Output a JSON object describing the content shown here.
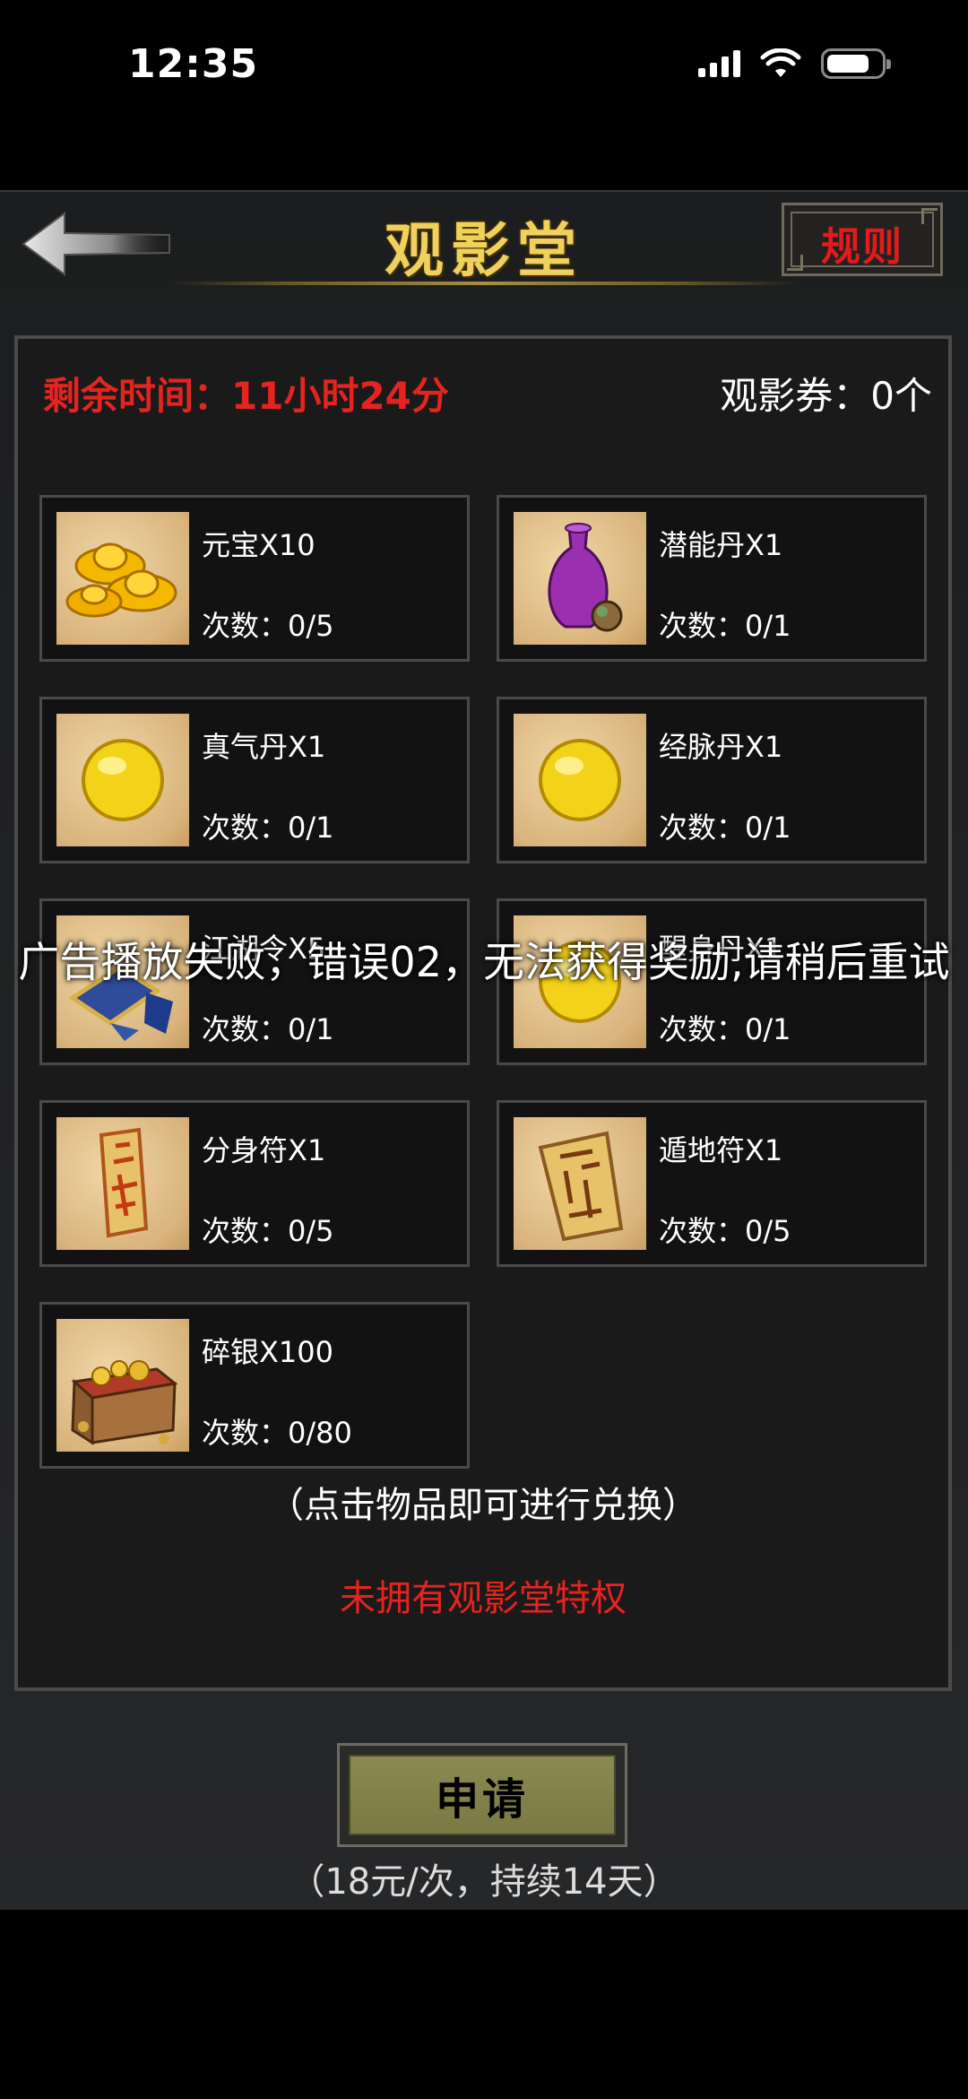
{
  "status_bar": {
    "time": "12:35"
  },
  "header": {
    "title": "观影堂",
    "rules_label": "规则"
  },
  "panel": {
    "time_remaining": "剩余时间：11小时24分",
    "ticket_count": "观影券：0个",
    "items": [
      {
        "name": "元宝X10",
        "count": "次数：0/5",
        "icon": "gold-ingot-icon"
      },
      {
        "name": "潜能丹X1",
        "count": "次数：0/1",
        "icon": "purple-vase-icon"
      },
      {
        "name": "真气丹X1",
        "count": "次数：0/1",
        "icon": "gold-pill-icon"
      },
      {
        "name": "经脉丹X1",
        "count": "次数：0/1",
        "icon": "gold-pill-icon"
      },
      {
        "name": "江湖令X5",
        "count": "次数：0/1",
        "icon": "token-icon"
      },
      {
        "name": "醒身丹X1",
        "count": "次数：0/1",
        "icon": "gold-pill-icon"
      },
      {
        "name": "分身符X1",
        "count": "次数：0/5",
        "icon": "talisman-icon"
      },
      {
        "name": "遁地符X1",
        "count": "次数：0/5",
        "icon": "talisman-icon"
      },
      {
        "name": "碎银X100",
        "count": "次数：0/80",
        "icon": "treasure-chest-icon"
      }
    ],
    "hint": "（点击物品即可进行兑换）",
    "no_privilege": "未拥有观影堂特权"
  },
  "apply": {
    "label": "申请",
    "price_note": "（18元/次，持续14天）"
  },
  "toast": {
    "message": "广告播放失败，错误02，无法获得奖励,请稍后重试"
  },
  "colors": {
    "title_gold": "#f0d15e",
    "alert_red": "#e52420",
    "button_olive": "#8b8a52"
  }
}
